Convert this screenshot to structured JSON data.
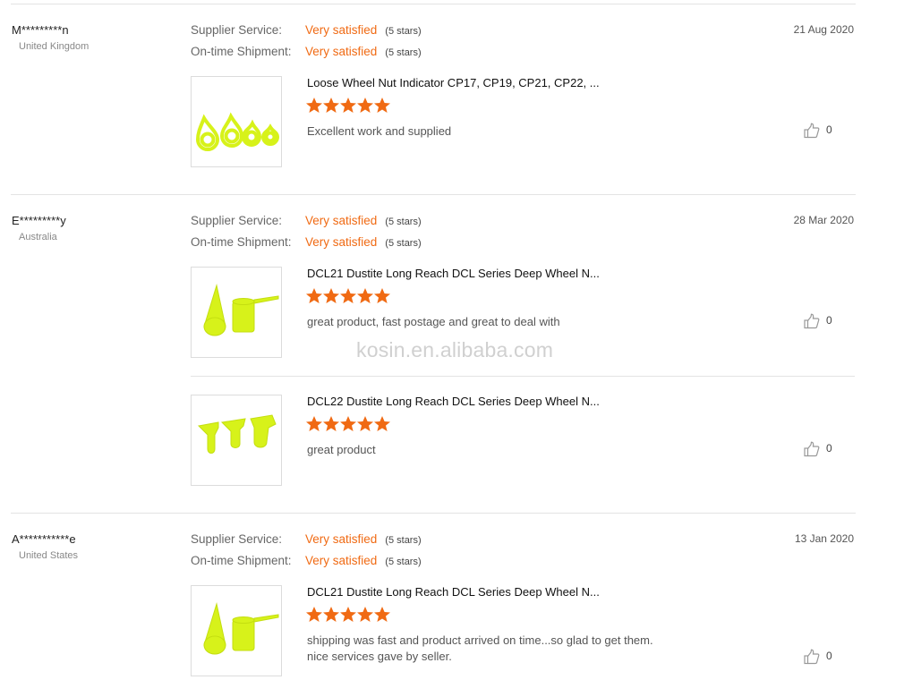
{
  "labels": {
    "supplier_service": "Supplier Service:",
    "ontime_shipment": "On-time Shipment:"
  },
  "colors": {
    "accent": "#f06a13",
    "product_yellow": "#d7f21a"
  },
  "reviews": [
    {
      "user": "M*********n",
      "country": "United Kingdom",
      "date": "21 Aug 2020",
      "supplier_service": {
        "value": "Very satisfied",
        "stars": "(5 stars)"
      },
      "ontime_shipment": {
        "value": "Very satisfied",
        "stars": "(5 stars)"
      },
      "products": [
        {
          "icon": "wheel-nut-indicator-image",
          "title": "Loose Wheel Nut Indicator CP17, CP19, CP21, CP22, ...",
          "rating": 5,
          "comment": "Excellent work and supplied",
          "likes": "0"
        }
      ]
    },
    {
      "user": "E*********y",
      "country": "Australia",
      "date": "28 Mar 2020",
      "supplier_service": {
        "value": "Very satisfied",
        "stars": "(5 stars)"
      },
      "ontime_shipment": {
        "value": "Very satisfied",
        "stars": "(5 stars)"
      },
      "products": [
        {
          "icon": "dustite-cap-image",
          "title": "DCL21 Dustite Long Reach DCL Series Deep Wheel N...",
          "rating": 5,
          "comment": "great product, fast postage and great to deal with",
          "likes": "0"
        },
        {
          "icon": "dustite-caps-image",
          "title": "DCL22 Dustite Long Reach DCL Series Deep Wheel N...",
          "rating": 5,
          "comment": "great product",
          "likes": "0"
        }
      ]
    },
    {
      "user": "A***********e",
      "country": "United States",
      "date": "13 Jan 2020",
      "supplier_service": {
        "value": "Very satisfied",
        "stars": "(5 stars)"
      },
      "ontime_shipment": {
        "value": "Very satisfied",
        "stars": "(5 stars)"
      },
      "products": [
        {
          "icon": "dustite-cap-image",
          "title": "DCL21 Dustite Long Reach DCL Series Deep Wheel N...",
          "rating": 5,
          "comment": "shipping was fast and product arrived on time...so glad to get them.\nnice services  gave by seller.",
          "likes": "0"
        }
      ]
    }
  ],
  "watermark": "kosin.en.alibaba.com"
}
